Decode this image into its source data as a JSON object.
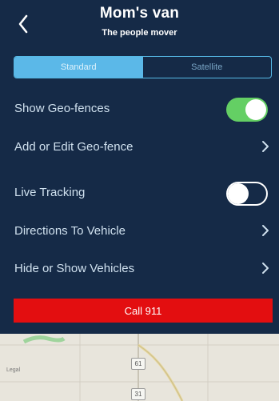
{
  "header": {
    "title": "Mom's van",
    "subtitle": "The people mover"
  },
  "map_type": {
    "options": [
      "Standard",
      "Satellite"
    ],
    "selected": "Standard"
  },
  "settings": [
    {
      "label": "Show Geo-fences",
      "control": "toggle",
      "state": "on"
    },
    {
      "label": "Add or Edit Geo-fence",
      "control": "chevron"
    },
    {
      "label": "Live Tracking",
      "control": "toggle",
      "state": "off"
    },
    {
      "label": "Directions To Vehicle",
      "control": "chevron"
    },
    {
      "label": "Hide or Show Vehicles",
      "control": "chevron"
    }
  ],
  "call_button": {
    "label": "Call 911"
  },
  "map": {
    "legal_label": "Legal",
    "road_shields": [
      "61",
      "31"
    ]
  },
  "colors": {
    "background": "#152a47",
    "accent": "#5bb8e8",
    "toggle_on": "#64cf64",
    "call_red": "#e30e10"
  },
  "icons": {
    "back": "chevron-left-icon",
    "disclosure": "chevron-right-icon"
  }
}
